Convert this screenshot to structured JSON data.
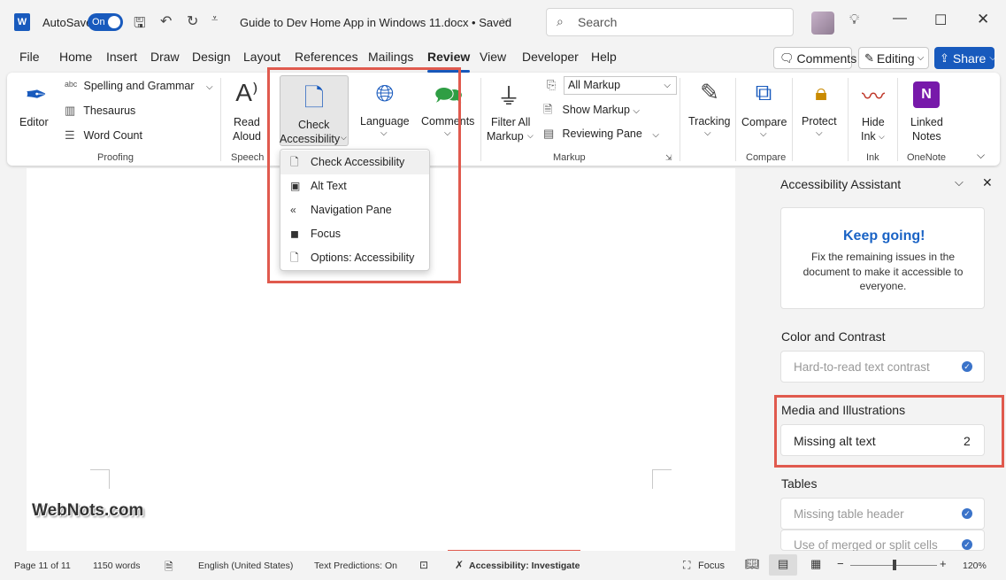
{
  "titlebar": {
    "autosave_label": "AutoSave",
    "toggle_label": "On",
    "doc_title": "Guide to Dev Home App in Windows 11.docx • Saved",
    "search_placeholder": "Search"
  },
  "menu": {
    "items": [
      "File",
      "Home",
      "Insert",
      "Draw",
      "Design",
      "Layout",
      "References",
      "Mailings",
      "Review",
      "View",
      "Developer",
      "Help"
    ],
    "active": "Review",
    "comments_btn": "Comments",
    "editing_btn": "Editing",
    "share_btn": "Share"
  },
  "ribbon": {
    "editor": "Editor",
    "spelling": "Spelling and Grammar",
    "thesaurus": "Thesaurus",
    "word_count": "Word Count",
    "proofing": "Proofing",
    "read_aloud_1": "Read",
    "read_aloud_2": "Aloud",
    "speech": "Speech",
    "check_1": "Check",
    "check_2": "Accessibility",
    "language": "Language",
    "comments": "Comments",
    "filter_1": "Filter All",
    "filter_2": "Markup",
    "all_markup": "All Markup",
    "show_markup": "Show Markup",
    "reviewing_pane": "Reviewing Pane",
    "markup": "Markup",
    "tracking": "Tracking",
    "compare": "Compare",
    "compare_group": "Compare",
    "protect": "Protect",
    "hide_ink_1": "Hide",
    "hide_ink_2": "Ink",
    "ink": "Ink",
    "linked_1": "Linked",
    "linked_2": "Notes",
    "onenote": "OneNote"
  },
  "dropdown": {
    "items": [
      "Check Accessibility",
      "Alt Text",
      "Navigation Pane",
      "Focus",
      "Options: Accessibility"
    ]
  },
  "document": {
    "watermark": "WebNots.com"
  },
  "pane": {
    "title": "Accessibility Assistant",
    "keep_going": "Keep going!",
    "keep_going_text": "Fix the remaining issues in the document to make it accessible to everyone.",
    "sections": [
      {
        "title": "Color and Contrast",
        "item": "Hard-to-read text contrast",
        "count": ""
      },
      {
        "title": "Media and Illustrations",
        "item": "Missing alt text",
        "count": "2"
      },
      {
        "title": "Tables",
        "item": "Missing table header",
        "item2": "Use of merged or split cells"
      }
    ]
  },
  "status": {
    "page": "Page 11 of 11",
    "words": "1150 words",
    "language": "English (United States)",
    "predictions": "Text Predictions: On",
    "accessibility": "Accessibility: Investigate",
    "focus": "Focus",
    "zoom": "120%"
  },
  "colors": {
    "accent": "#185abd",
    "highlight": "#e05a4e",
    "keep_going": "#1a63c5"
  }
}
